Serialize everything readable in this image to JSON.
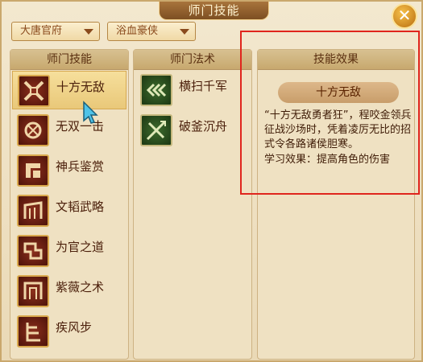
{
  "title": "师门技能",
  "close_label": "✕",
  "dropdowns": [
    {
      "value": "大唐官府"
    },
    {
      "value": "浴血豪侠"
    }
  ],
  "panels": {
    "skills": {
      "header": "师门技能"
    },
    "spells": {
      "header": "师门法术"
    },
    "effect": {
      "header": "技能效果"
    }
  },
  "skills": [
    {
      "label": "十方无敌",
      "icon": "crossed-swords-icon",
      "selected": true
    },
    {
      "label": "无双一击",
      "icon": "fist-icon"
    },
    {
      "label": "神兵鉴赏",
      "icon": "weapon-icon"
    },
    {
      "label": "文韬武略",
      "icon": "gate-icon"
    },
    {
      "label": "为官之道",
      "icon": "seal-icon"
    },
    {
      "label": "紫薇之术",
      "icon": "star-icon"
    },
    {
      "label": "疾风步",
      "icon": "wind-icon"
    }
  ],
  "spells": [
    {
      "label": "横扫千军",
      "icon": "sweep-icon"
    },
    {
      "label": "破釜沉舟",
      "icon": "cross-blade-icon"
    }
  ],
  "effect": {
    "title": "十方无敌",
    "description": "“十方无敌勇者狂”，程咬金领兵征战沙场时，凭着凌厉无比的招式令各路诸侯胆寒。",
    "learn_effect": "学习效果：提高角色的伤害"
  },
  "colors": {
    "highlight": "#e0251d",
    "skill_icon": "#8b2f1c",
    "spell_icon": "#3d6b2d"
  }
}
